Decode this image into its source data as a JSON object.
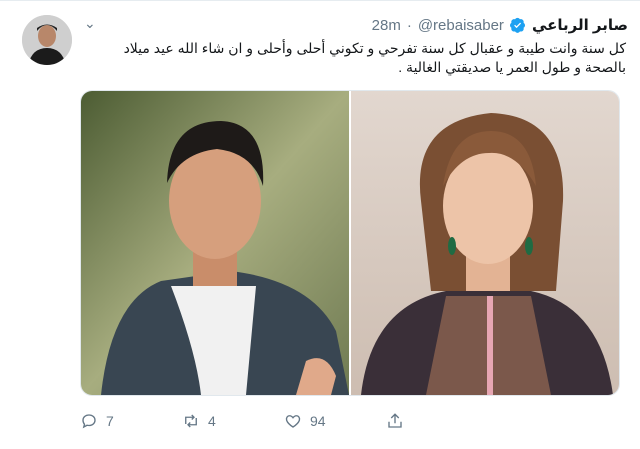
{
  "tweet": {
    "display_name": "صابر الرباعي",
    "handle": "@rebaisaber",
    "separator": "·",
    "time": "28m",
    "text": "كل سنة وانت طيبة و عقبال كل سنة تفرحي و تكوني أحلى وأحلى و ان شاء الله عيد ميلاد بالصحة و طول العمر يا صديقتي الغالية ."
  },
  "actions": {
    "reply_count": "7",
    "retweet_count": "4",
    "like_count": "94"
  },
  "colors": {
    "accent": "#1da1f2",
    "muted": "#657786",
    "text": "#14171a"
  }
}
